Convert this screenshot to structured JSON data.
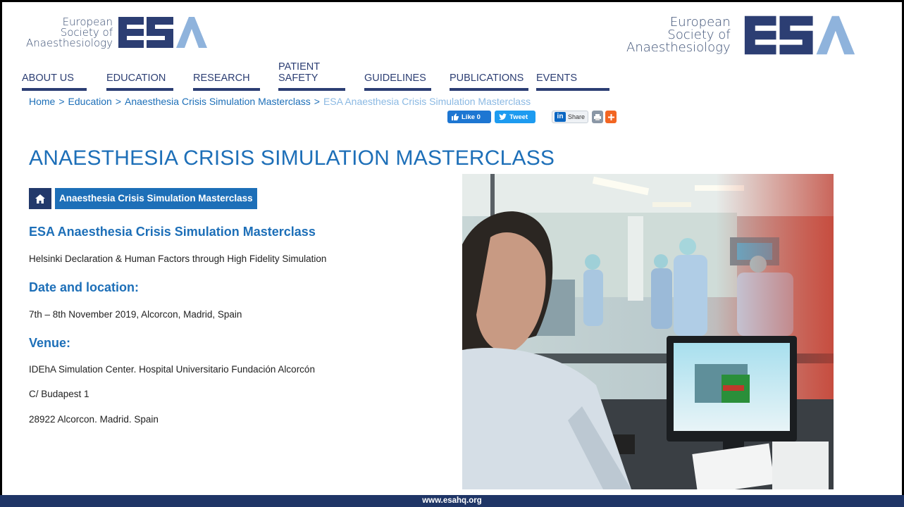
{
  "logo": {
    "line1": "European",
    "line2": "Society of",
    "line3": "Anaesthesiology",
    "mark": "ESA"
  },
  "nav": {
    "items": [
      {
        "label": "ABOUT US"
      },
      {
        "label": "EDUCATION"
      },
      {
        "label": "RESEARCH"
      },
      {
        "label": "PATIENT SAFETY",
        "line1": "PATIENT",
        "line2": "SAFETY"
      },
      {
        "label": "GUIDELINES"
      },
      {
        "label": "PUBLICATIONS"
      },
      {
        "label": "EVENTS"
      }
    ]
  },
  "breadcrumb": {
    "items": [
      "Home",
      "Education",
      "Anaesthesia Crisis Simulation Masterclass"
    ],
    "separator": ">",
    "current": "ESA Anaesthesia Crisis Simulation Masterclass"
  },
  "share": {
    "like": "Like 0",
    "tweet": "Tweet",
    "linkedin": "Share"
  },
  "page": {
    "title": "ANAESTHESIA CRISIS SIMULATION MASTERCLASS",
    "tag": "Anaesthesia Crisis Simulation Masterclass",
    "heading": "ESA Anaesthesia Crisis Simulation Masterclass",
    "subtitle": "Helsinki Declaration & Human Factors through High Fidelity Simulation",
    "date_heading": "Date and location:",
    "date_text": "7th – 8th November 2019, Alcorcon, Madrid, Spain",
    "venue_heading": "Venue:",
    "venue_line1": "IDEhA Simulation Center. Hospital Universitario Fundación Alcorcón",
    "venue_line2": "C/ Budapest 1",
    "venue_line3": "28922 Alcorcon. Madrid. Spain"
  },
  "footer": {
    "url": "www.esahq.org"
  },
  "colors": {
    "brand_dark": "#2c3e73",
    "brand_blue": "#1d6fb8",
    "brand_light": "#8fb3dc",
    "footer": "#1f3566"
  }
}
